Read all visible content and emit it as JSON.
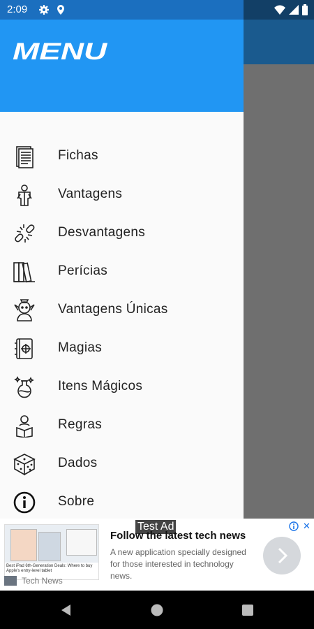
{
  "status_bar": {
    "time": "2:09"
  },
  "drawer": {
    "title": "MENU",
    "items": [
      {
        "label": "Fichas",
        "icon": "document-icon"
      },
      {
        "label": "Vantagens",
        "icon": "hero-icon"
      },
      {
        "label": "Desvantagens",
        "icon": "broken-chain-icon"
      },
      {
        "label": "Perícias",
        "icon": "books-icon"
      },
      {
        "label": "Vantagens Únicas",
        "icon": "elf-icon"
      },
      {
        "label": "Magias",
        "icon": "spellbook-icon"
      },
      {
        "label": "Itens Mágicos",
        "icon": "potion-icon"
      },
      {
        "label": "Regras",
        "icon": "reader-icon"
      },
      {
        "label": "Dados",
        "icon": "dice-icon"
      },
      {
        "label": "Sobre",
        "icon": "info-icon"
      }
    ]
  },
  "ad": {
    "badge": "Test Ad",
    "headline": "Follow the latest tech news",
    "body": "A new application specially designed for those interested in technology news.",
    "source": "Tech News",
    "image_caption": "Best iPad 6th-Generation Deals: Where to buy Apple's entry-level tablet",
    "close": "✕"
  },
  "colors": {
    "header": "#2196f3",
    "status_bar": "#1b6fbf",
    "toolbar": "#1a5a8e"
  }
}
